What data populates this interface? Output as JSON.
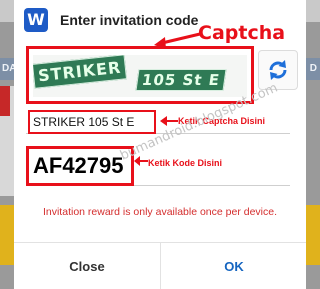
{
  "background": {
    "strip_left_text": "DAM",
    "strip_right_text": "D"
  },
  "dialog": {
    "app_icon_letter": "W",
    "title": "Enter invitation code",
    "captcha_words": [
      "STRIKER",
      "105 St E"
    ],
    "captcha_input_value": "STRIKER 105 St E",
    "invitation_code_value": "AF42795",
    "notice": "Invitation reward is only available once per device.",
    "close_label": "Close",
    "ok_label": "OK",
    "refresh_icon": "refresh-icon"
  },
  "annotations": {
    "captcha_label": "Captcha",
    "captcha_hint": "Ketik Captcha Disini",
    "code_hint": "Ketik Kode Disini",
    "watermark": "bumandroid.blogspot.com",
    "color": "#e8101a"
  },
  "colors": {
    "accent": "#1565c0",
    "notice": "#d42e2e",
    "app_icon": "#1e5bc6"
  }
}
